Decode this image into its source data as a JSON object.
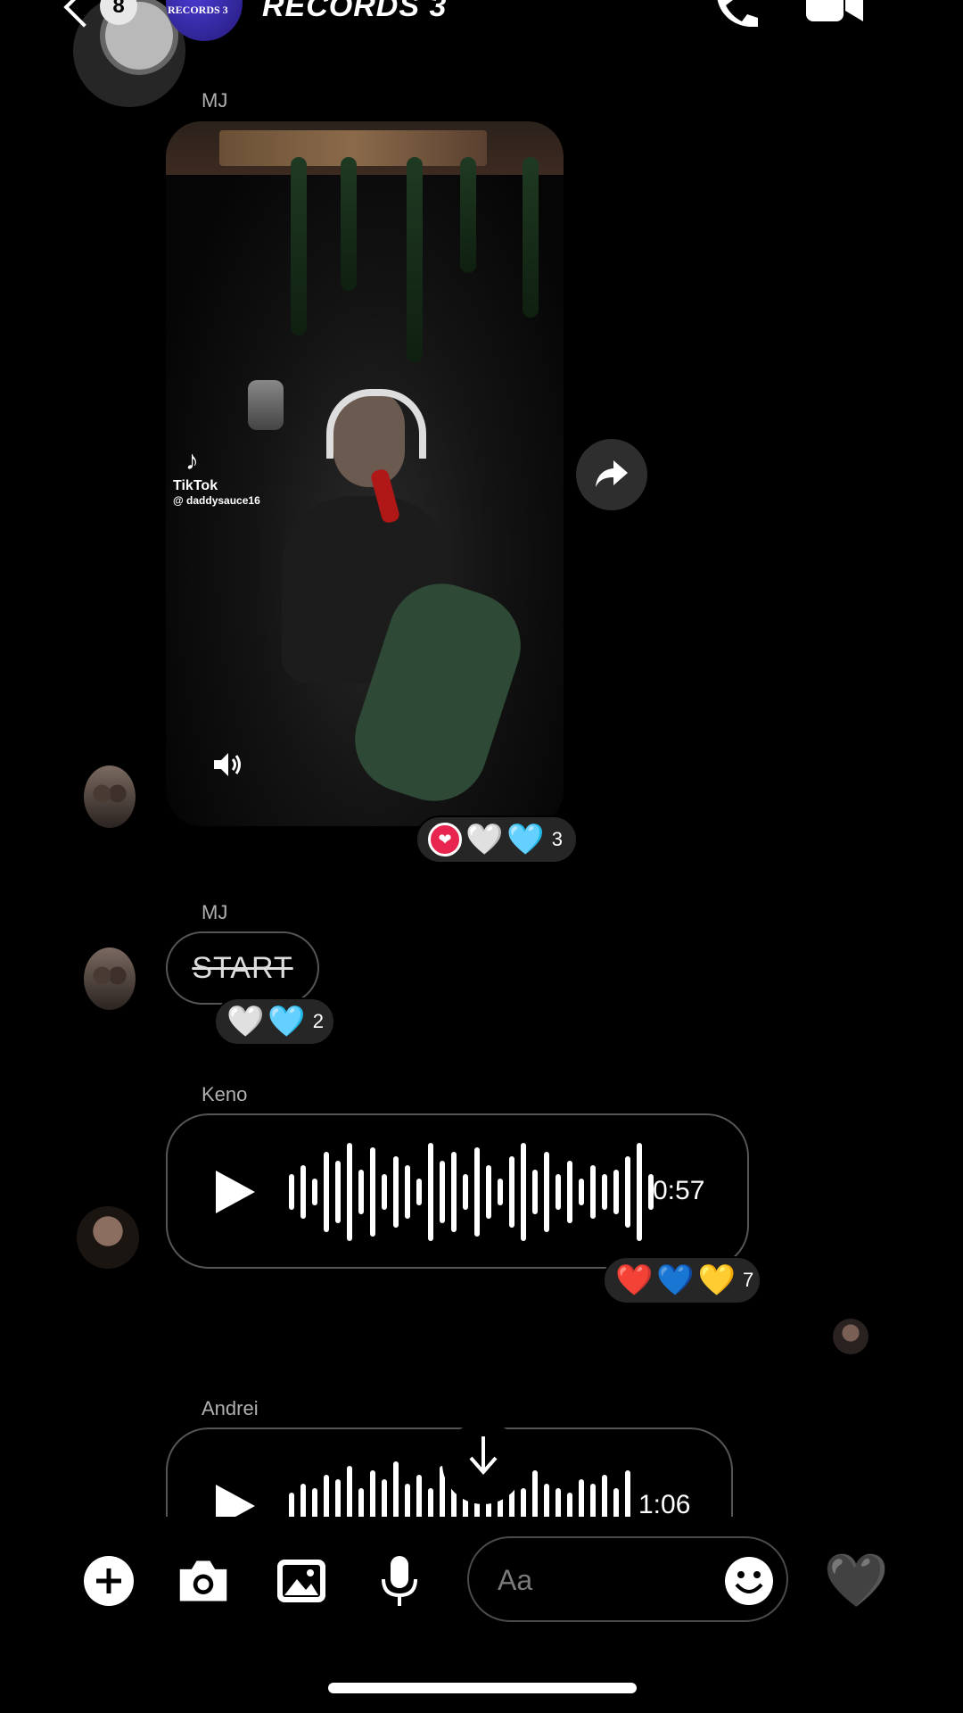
{
  "header": {
    "back_count": "8",
    "group_avatar_text": "RECORDS 3",
    "group_name": "RECORDS 3",
    "phone_icon": "phone-icon",
    "video_icon": "video-call-icon"
  },
  "messages": [
    {
      "sender": "MJ",
      "type": "video",
      "source_logo": "TikTok",
      "source_handle": "@ daddysauce16",
      "reactions": [
        "❤",
        "🤍",
        "🩵"
      ],
      "reaction_count": "3"
    },
    {
      "sender": "MJ",
      "type": "text",
      "text": "START",
      "reactions": [
        "🤍",
        "🩵"
      ],
      "reaction_count": "2"
    },
    {
      "sender": "Keno",
      "type": "audio",
      "duration": "0:57",
      "reactions": [
        "❤️",
        "💙",
        "💛"
      ],
      "reaction_count": "7"
    },
    {
      "sender": "Andrei",
      "type": "audio",
      "duration": "1:06"
    }
  ],
  "composer": {
    "placeholder": "Aa",
    "like_emoji": "🖤"
  },
  "colors": {
    "background": "#000000",
    "bubble_border": "#555555",
    "reaction_bg": "#262626",
    "like_red": "#e8254e"
  }
}
